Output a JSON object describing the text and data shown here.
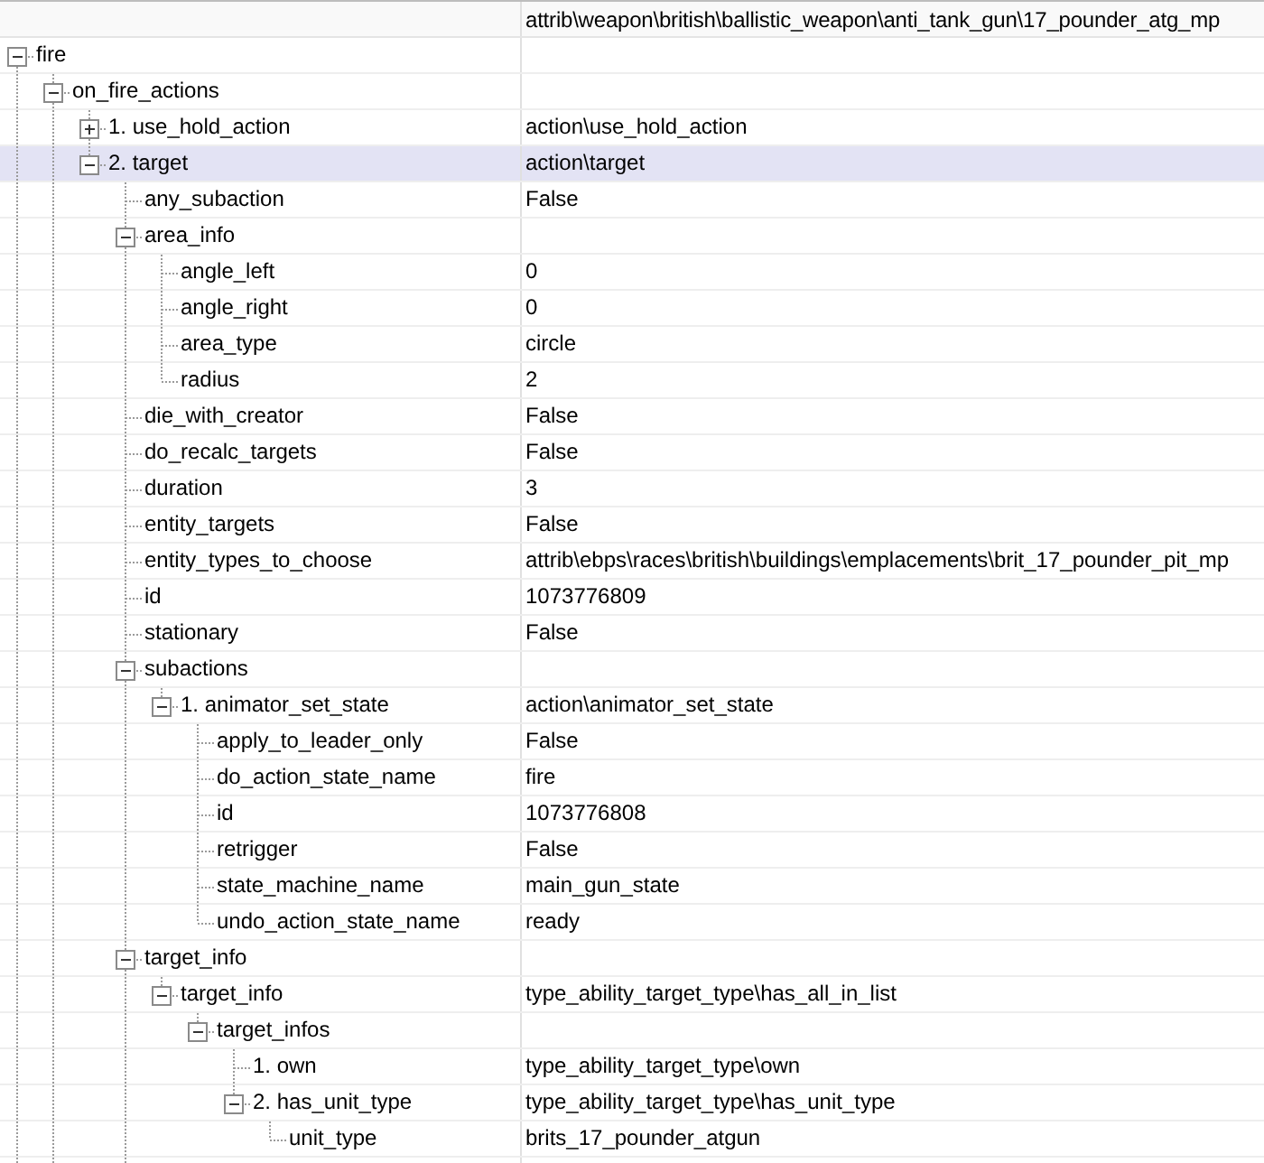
{
  "header": {
    "path": "attrib\\weapon\\british\\ballistic_weapon\\anti_tank_gun\\17_pounder_atg_mp"
  },
  "tree": [
    {
      "label": "fire",
      "expanded": true,
      "selected": false,
      "more_below": true,
      "children": [
        {
          "label": "on_fire_actions",
          "expanded": true,
          "selected": false,
          "more_below": true,
          "children": [
            {
              "label": "1. use_hold_action",
              "value": "action\\use_hold_action",
              "expanded": false,
              "selected": false
            },
            {
              "label": "2. target",
              "value": "action\\target",
              "expanded": true,
              "selected": true,
              "children": [
                {
                  "label": "any_subaction",
                  "value": "False",
                  "selected": false
                },
                {
                  "label": "area_info",
                  "expanded": true,
                  "selected": false,
                  "children": [
                    {
                      "label": "angle_left",
                      "value": "0",
                      "selected": false
                    },
                    {
                      "label": "angle_right",
                      "value": "0",
                      "selected": false
                    },
                    {
                      "label": "area_type",
                      "value": "circle",
                      "selected": false
                    },
                    {
                      "label": "radius",
                      "value": "2",
                      "selected": false
                    }
                  ]
                },
                {
                  "label": "die_with_creator",
                  "value": "False",
                  "selected": false
                },
                {
                  "label": "do_recalc_targets",
                  "value": "False",
                  "selected": false
                },
                {
                  "label": "duration",
                  "value": "3",
                  "selected": false
                },
                {
                  "label": "entity_targets",
                  "value": "False",
                  "selected": false
                },
                {
                  "label": "entity_types_to_choose",
                  "value": "attrib\\ebps\\races\\british\\buildings\\emplacements\\brit_17_pounder_pit_mp",
                  "selected": false
                },
                {
                  "label": "id",
                  "value": "1073776809",
                  "selected": false
                },
                {
                  "label": "stationary",
                  "value": "False",
                  "selected": false
                },
                {
                  "label": "subactions",
                  "expanded": true,
                  "selected": false,
                  "children": [
                    {
                      "label": "1. animator_set_state",
                      "value": "action\\animator_set_state",
                      "expanded": true,
                      "selected": false,
                      "children": [
                        {
                          "label": "apply_to_leader_only",
                          "value": "False",
                          "selected": false
                        },
                        {
                          "label": "do_action_state_name",
                          "value": "fire",
                          "selected": false
                        },
                        {
                          "label": "id",
                          "value": "1073776808",
                          "selected": false
                        },
                        {
                          "label": "retrigger",
                          "value": "False",
                          "selected": false
                        },
                        {
                          "label": "state_machine_name",
                          "value": "main_gun_state",
                          "selected": false
                        },
                        {
                          "label": "undo_action_state_name",
                          "value": "ready",
                          "selected": false
                        }
                      ]
                    }
                  ]
                },
                {
                  "label": "target_info",
                  "expanded": true,
                  "selected": false,
                  "more_below": true,
                  "children": [
                    {
                      "label": "target_info",
                      "value": "type_ability_target_type\\has_all_in_list",
                      "expanded": true,
                      "selected": false,
                      "children": [
                        {
                          "label": "target_infos",
                          "expanded": true,
                          "selected": false,
                          "children": [
                            {
                              "label": "1. own",
                              "value": "type_ability_target_type\\own",
                              "selected": false
                            },
                            {
                              "label": "2. has_unit_type",
                              "value": "type_ability_target_type\\has_unit_type",
                              "expanded": true,
                              "selected": false,
                              "children": [
                                {
                                  "label": "unit_type",
                                  "value": "brits_17_pounder_atgun",
                                  "selected": false
                                }
                              ]
                            }
                          ]
                        }
                      ]
                    }
                  ]
                }
              ]
            }
          ]
        }
      ]
    }
  ]
}
